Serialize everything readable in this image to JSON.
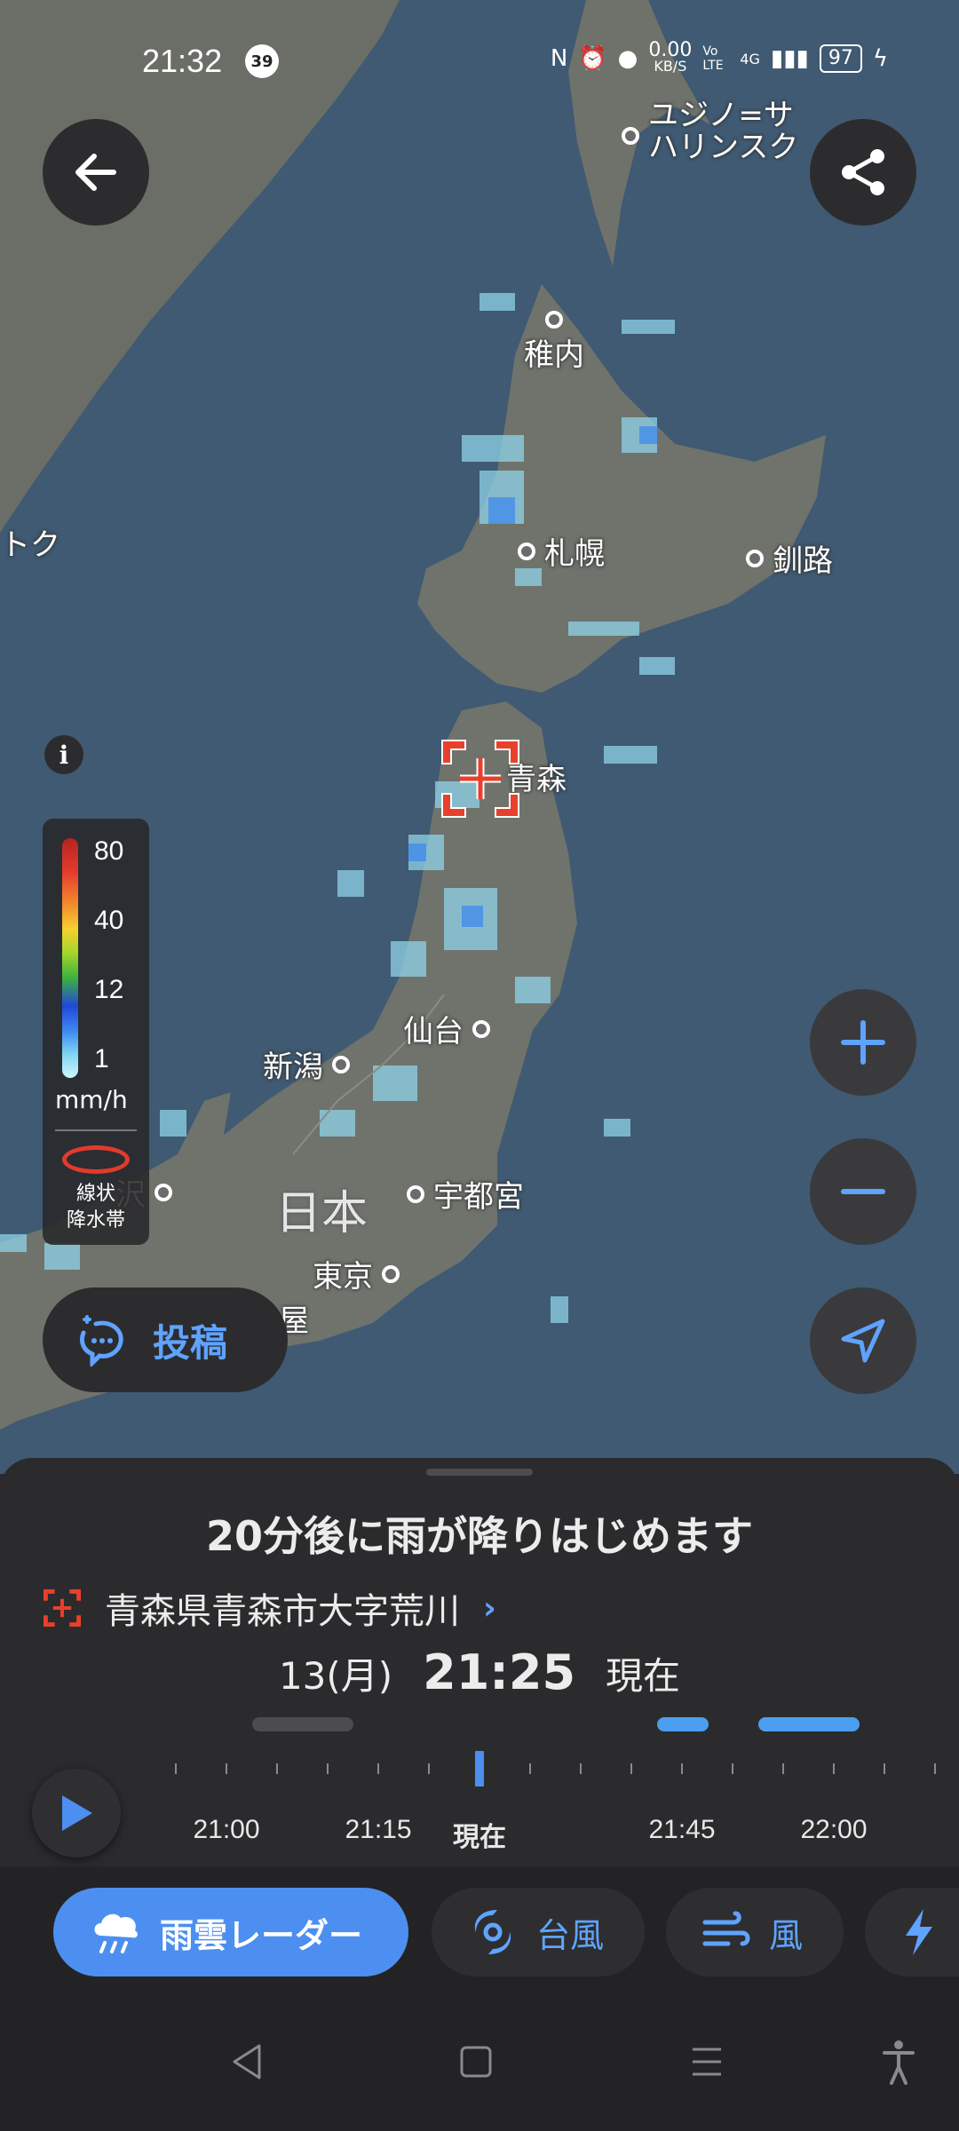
{
  "status_bar": {
    "time": "21:32",
    "notification_count": "39",
    "net_speed_value": "0.00",
    "net_speed_unit": "KB/S",
    "volte": "Vo LTE",
    "network": "4G",
    "battery": "97"
  },
  "map": {
    "cities": {
      "yuzhno": "ユジノ=サ\nハリンスク",
      "wakkanai": "稚内",
      "sapporo": "札幌",
      "kushiro": "釧路",
      "aomori": "青森",
      "sendai": "仙台",
      "niigata": "新潟",
      "kanazawa": "沢",
      "utsunomiya": "宇都宮",
      "tokyo": "東京",
      "nagoya": "屋",
      "okhotsk": "トク"
    },
    "country_label": "日本"
  },
  "legend": {
    "ticks": [
      "80",
      "40",
      "12",
      "1"
    ],
    "unit": "mm/h",
    "band_label_line1": "線状",
    "band_label_line2": "降水帯"
  },
  "post_button": {
    "label": "投稿"
  },
  "sheet": {
    "headline": "20分後に雨が降りはじめます",
    "location": "青森県青森市大字荒川",
    "date": "13(月)",
    "time": "21:25",
    "now_label": "現在"
  },
  "timeline": {
    "labels": [
      "21:00",
      "21:15",
      "現在",
      "21:45",
      "22:00"
    ]
  },
  "tabs": {
    "rain_radar": "雨雲レーダー",
    "typhoon": "台風",
    "wind": "風"
  },
  "colors": {
    "accent": "#4c8ff0",
    "accent_text": "#5fa3ff",
    "marker_red": "#e8402c",
    "sea": "#3f5a72",
    "land": "#6f736c"
  }
}
